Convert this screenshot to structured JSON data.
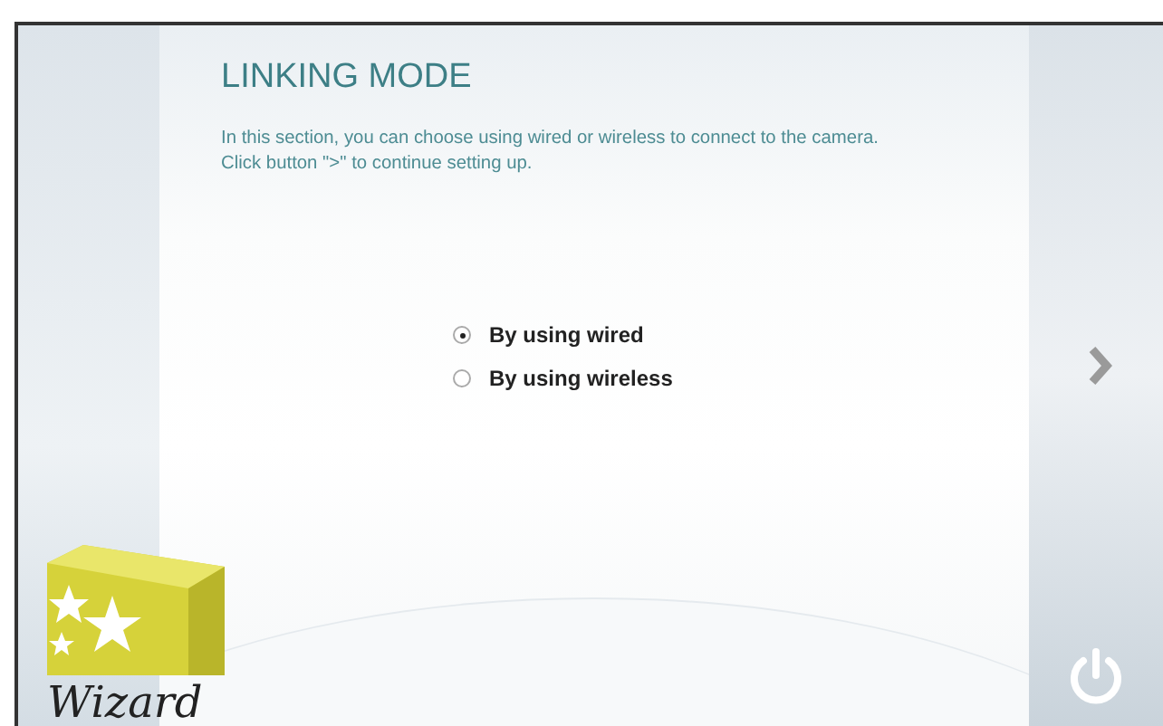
{
  "title": "LINKING MODE",
  "description": "In this section, you can choose using wired or wireless to connect to the camera. Click button \">\" to continue setting up.",
  "options": [
    {
      "label": "By using wired",
      "selected": true
    },
    {
      "label": "By using wireless",
      "selected": false
    }
  ],
  "logo": {
    "text": "Wizard"
  }
}
